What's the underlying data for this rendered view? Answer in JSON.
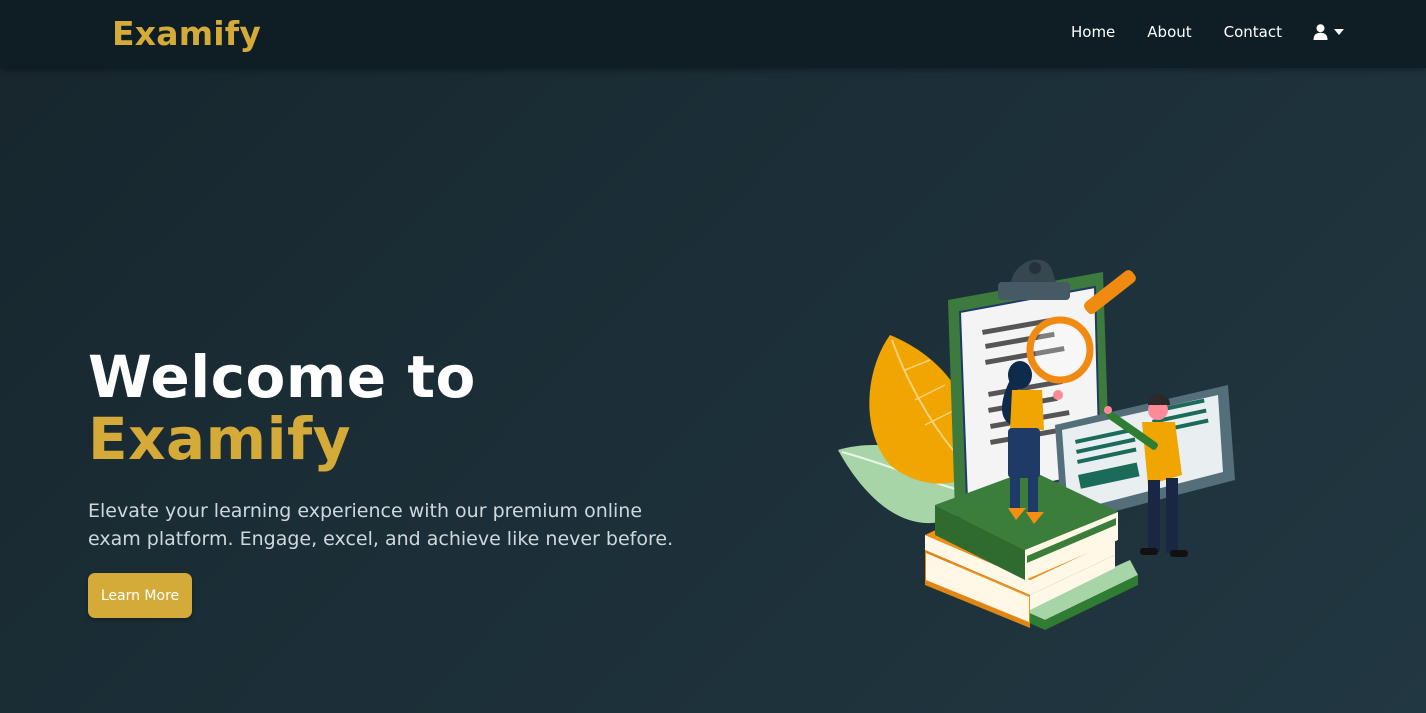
{
  "brand": {
    "name": "Examify",
    "accent_color": "#d4aa38"
  },
  "nav": {
    "items": [
      {
        "label": "Home"
      },
      {
        "label": "About"
      },
      {
        "label": "Contact"
      }
    ],
    "user_menu_icon": "user-icon",
    "dropdown_icon": "caret-down-icon"
  },
  "hero": {
    "title_line1": "Welcome to",
    "title_line2": "Examify",
    "description": "Elevate your learning experience with our premium online exam platform. Engage, excel, and achieve like never before.",
    "cta_label": "Learn More"
  },
  "illustration": {
    "icon": "exam-study-illustration"
  }
}
